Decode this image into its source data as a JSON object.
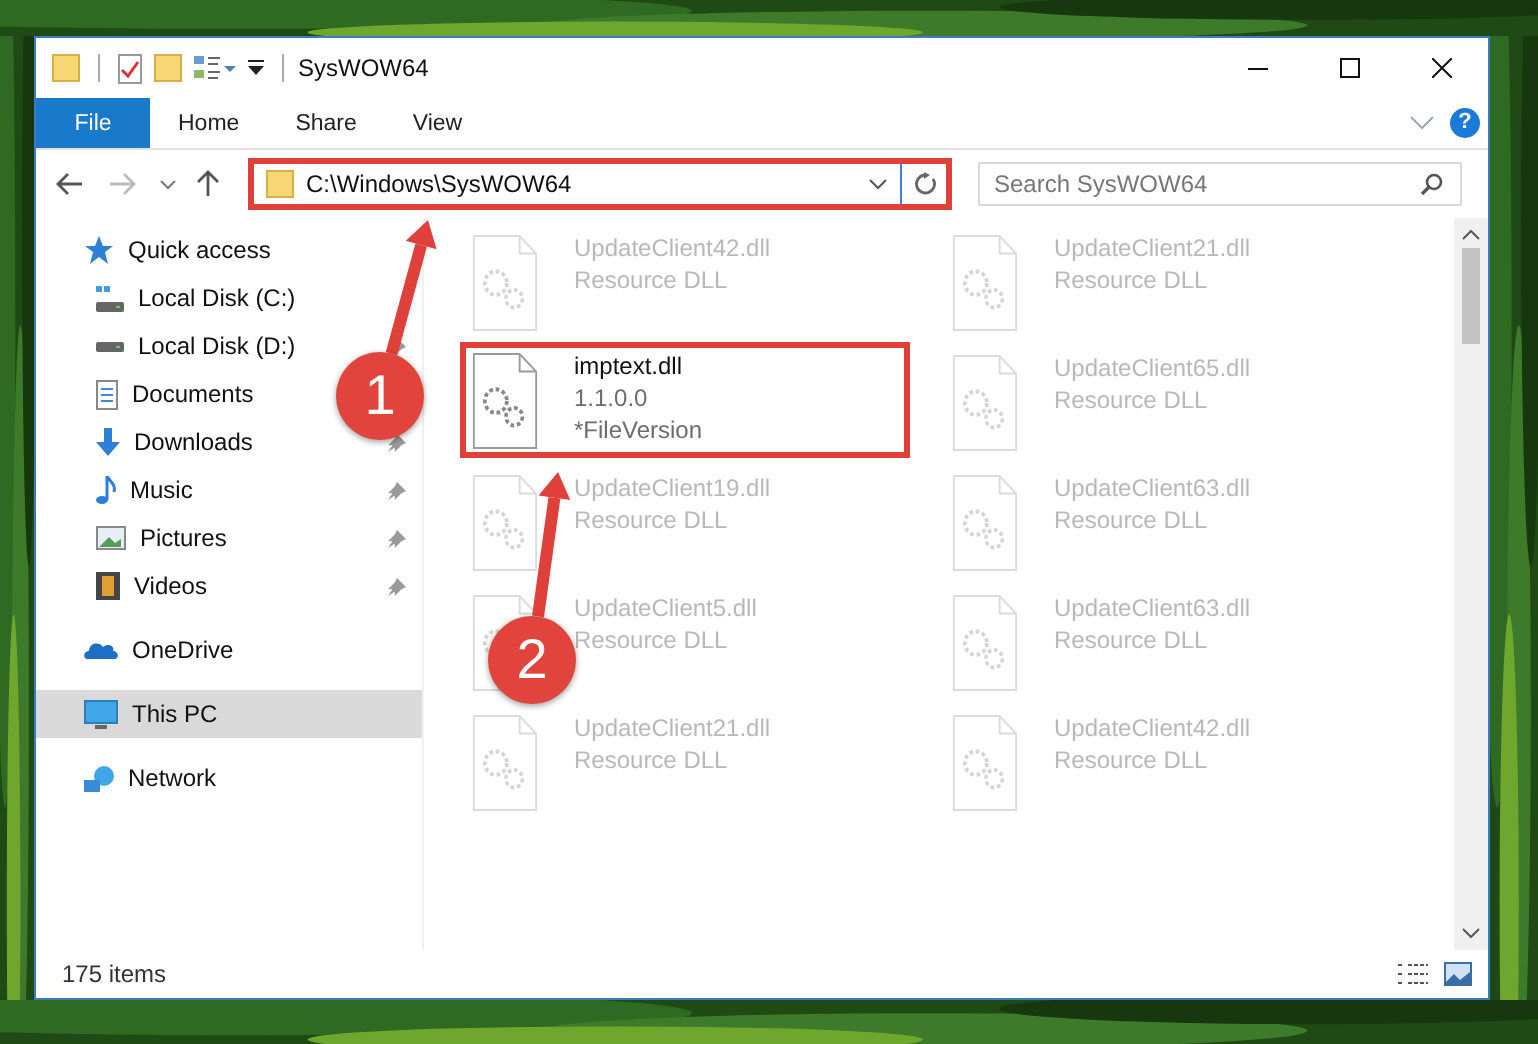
{
  "window": {
    "title": "SysWOW64"
  },
  "ribbon": {
    "tabs": [
      {
        "label": "File",
        "selected": true
      },
      {
        "label": "Home",
        "selected": false
      },
      {
        "label": "Share",
        "selected": false
      },
      {
        "label": "View",
        "selected": false
      }
    ],
    "help": "?"
  },
  "address_bar": {
    "path": "C:\\Windows\\SysWOW64",
    "highlighted": true
  },
  "search": {
    "placeholder": "Search SysWOW64"
  },
  "sidebar": {
    "items": [
      {
        "label": "Quick access",
        "kind": "star",
        "selected": false,
        "children": [
          {
            "label": "Local Disk (C:)",
            "kind": "drive-c",
            "pinned": false,
            "selected": false
          },
          {
            "label": "Local Disk (D:)",
            "kind": "drive",
            "pinned": true,
            "selected": false
          },
          {
            "label": "Documents",
            "kind": "document",
            "pinned": false,
            "selected": false
          },
          {
            "label": "Downloads",
            "kind": "download",
            "pinned": true,
            "selected": false
          },
          {
            "label": "Music",
            "kind": "music",
            "pinned": true,
            "selected": false
          },
          {
            "label": "Pictures",
            "kind": "pictures",
            "pinned": true,
            "selected": false
          },
          {
            "label": "Videos",
            "kind": "videos",
            "pinned": true,
            "selected": false
          }
        ]
      },
      {
        "label": "OneDrive",
        "kind": "cloud",
        "selected": false
      },
      {
        "label": "This PC",
        "kind": "computer",
        "selected": true
      },
      {
        "label": "Network",
        "kind": "network",
        "selected": false
      }
    ]
  },
  "files": [
    {
      "name": "UpdateClient42.dll",
      "details": [
        "Resource DLL"
      ],
      "blurred": true,
      "highlighted": false
    },
    {
      "name": "UpdateClient21.dll",
      "details": [
        "Resource DLL"
      ],
      "blurred": true,
      "highlighted": false
    },
    {
      "name": "imptext.dll",
      "details": [
        "1.1.0.0",
        "*FileVersion"
      ],
      "blurred": false,
      "highlighted": true
    },
    {
      "name": "UpdateClient65.dll",
      "details": [
        "Resource DLL"
      ],
      "blurred": true,
      "highlighted": false
    },
    {
      "name": "UpdateClient19.dll",
      "details": [
        "Resource DLL"
      ],
      "blurred": true,
      "highlighted": false
    },
    {
      "name": "UpdateClient63.dll",
      "details": [
        "Resource DLL"
      ],
      "blurred": true,
      "highlighted": false
    },
    {
      "name": "UpdateClient5.dll",
      "details": [
        "Resource DLL"
      ],
      "blurred": true,
      "highlighted": false
    },
    {
      "name": "UpdateClient63.dll",
      "details": [
        "Resource DLL"
      ],
      "blurred": true,
      "highlighted": false
    },
    {
      "name": "UpdateClient21.dll",
      "details": [
        "Resource DLL"
      ],
      "blurred": true,
      "highlighted": false
    },
    {
      "name": "UpdateClient42.dll",
      "details": [
        "Resource DLL"
      ],
      "blurred": true,
      "highlighted": false
    }
  ],
  "status_bar": {
    "item_count": "175 items"
  },
  "callouts": [
    {
      "number": "1"
    },
    {
      "number": "2"
    }
  ]
}
